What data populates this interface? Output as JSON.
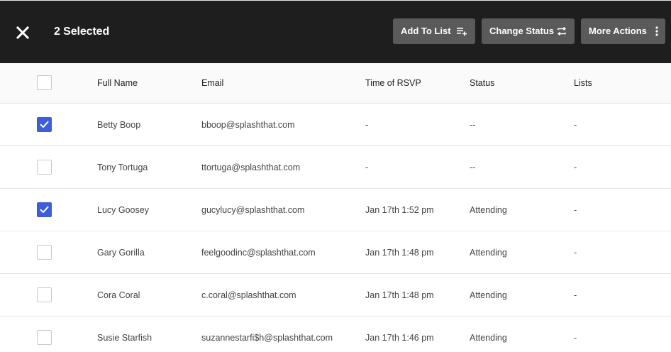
{
  "topbar": {
    "selected_label": "2 Selected",
    "background": "#1e1e1e",
    "close_icon": "close-icon",
    "actions": [
      {
        "label": "Add To List",
        "icon": "playlist-add-icon"
      },
      {
        "label": "Change Status",
        "icon": "swap-arrows-icon"
      },
      {
        "label": "More Actions",
        "icon": "vertical-dots-icon"
      }
    ]
  },
  "accent_color": "#3d5ed8",
  "table": {
    "columns": [
      "Full Name",
      "Email",
      "Time of RSVP",
      "Status",
      "Lists"
    ],
    "rows": [
      {
        "checked": true,
        "name": "Betty Boop",
        "email": "bboop@splashthat.com",
        "time": "-",
        "status": "--",
        "lists": "-"
      },
      {
        "checked": false,
        "name": "Tony Tortuga",
        "email": "ttortuga@splashthat.com",
        "time": "-",
        "status": "--",
        "lists": "-"
      },
      {
        "checked": true,
        "name": "Lucy Goosey",
        "email": "gucylucy@splashthat.com",
        "time": "Jan 17th 1:52 pm",
        "status": "Attending",
        "lists": "-"
      },
      {
        "checked": false,
        "name": "Gary Gorilla",
        "email": "feelgoodinc@splashthat.com",
        "time": "Jan 17th 1:48 pm",
        "status": "Attending",
        "lists": "-"
      },
      {
        "checked": false,
        "name": "Cora Coral",
        "email": "c.coral@splashthat.com",
        "time": "Jan 17th 1:48 pm",
        "status": "Attending",
        "lists": "-"
      },
      {
        "checked": false,
        "name": "Susie Starfish",
        "email": "suzannestarfi$h@splashthat.com",
        "time": "Jan 17th 1:46 pm",
        "status": "Attending",
        "lists": "-"
      }
    ]
  }
}
